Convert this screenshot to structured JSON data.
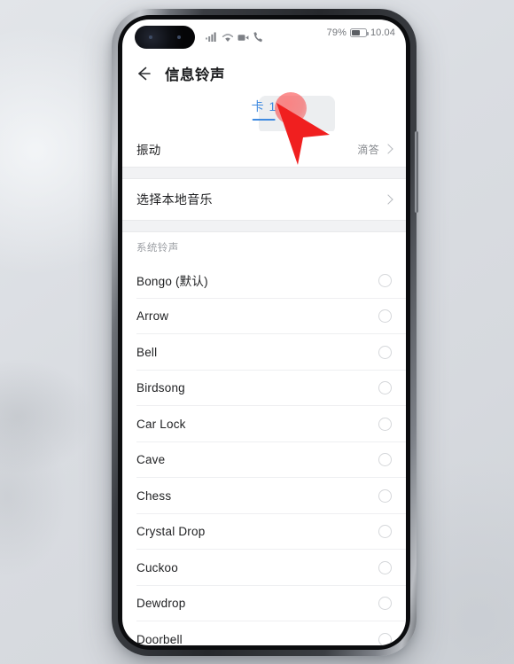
{
  "device": {
    "type": "smartphone",
    "frame_color": "#2a2c30"
  },
  "status_bar": {
    "signal_icon": "signal-bars-icon",
    "wifi_icon": "wifi-icon",
    "video_icon": "video-camera-icon",
    "call_icon": "phone-call-icon",
    "battery_percent": "79%",
    "battery_icon": "battery-icon",
    "time": "10.04"
  },
  "navbar": {
    "back_icon": "back-arrow-icon",
    "title": "信息铃声"
  },
  "tabs": [
    {
      "label": "卡 1",
      "active": true,
      "accent": "#3f8ae0"
    }
  ],
  "rows": {
    "vibration": {
      "title": "振动",
      "value": "滴答",
      "chevron_icon": "chevron-right-icon"
    },
    "local_music": {
      "title": "选择本地音乐",
      "chevron_icon": "chevron-right-icon"
    }
  },
  "section": {
    "header": "系统铃声"
  },
  "ringtones": [
    {
      "name": "Bongo (默认)",
      "selected": false
    },
    {
      "name": "Arrow",
      "selected": false
    },
    {
      "name": "Bell",
      "selected": false
    },
    {
      "name": "Birdsong",
      "selected": false
    },
    {
      "name": "Car Lock",
      "selected": false
    },
    {
      "name": "Cave",
      "selected": false
    },
    {
      "name": "Chess",
      "selected": false
    },
    {
      "name": "Crystal Drop",
      "selected": false
    },
    {
      "name": "Cuckoo",
      "selected": false
    },
    {
      "name": "Dewdrop",
      "selected": false
    },
    {
      "name": "Doorbell",
      "selected": false
    }
  ],
  "annotation": {
    "touch_indicator": "touch-point-marker",
    "cursor": "arrow-cursor",
    "accent_color": "#f02020"
  }
}
